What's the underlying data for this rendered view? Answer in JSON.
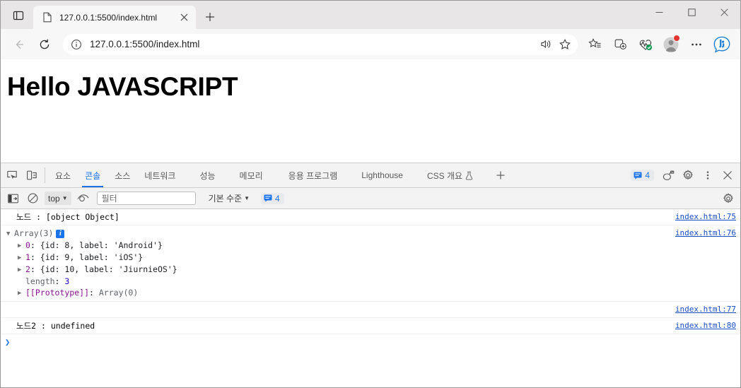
{
  "window": {
    "minimize_label": "−",
    "maximize_label": "□",
    "close_label": "×"
  },
  "tabstrip": {
    "tab_search_icon": "tab-search-icon",
    "tabs": [
      {
        "title": "127.0.0.1:5500/index.html",
        "favicon": "document-icon",
        "close_label": "×",
        "active": true
      }
    ],
    "new_tab_label": "+"
  },
  "toolbar": {
    "back_label": "←",
    "forward_label": "→",
    "refresh_label": "⟳",
    "info_icon": "site-info-icon",
    "url": "127.0.0.1:5500/index.html",
    "read_aloud_icon": "read-aloud-icon",
    "favorite_icon": "star-icon",
    "collections_icon": "collections-star-icon",
    "add_tab_group_icon": "add-tab-group-icon",
    "browser_essentials_icon": "browser-essentials-icon",
    "profile_icon": "profile-avatar-icon",
    "settings_more_icon": "more-options-icon",
    "copilot_icon": "bing-copilot-icon"
  },
  "page": {
    "heading": "Hello JAVASCRIPT"
  },
  "devtools": {
    "inspect_icon": "inspect-element-icon",
    "device_toolbar_icon": "device-toolbar-icon",
    "tabs": [
      {
        "label": "요소",
        "active": false
      },
      {
        "label": "콘솔",
        "active": true
      },
      {
        "label": "소스",
        "active": false
      },
      {
        "label": "네트워크",
        "active": false
      },
      {
        "label": "성능",
        "active": false
      },
      {
        "label": "메모리",
        "active": false
      },
      {
        "label": "응용 프로그램",
        "active": false
      },
      {
        "label": "Lighthouse",
        "active": false
      },
      {
        "label": "CSS 개요",
        "active": false,
        "experiment_icon": "flask-icon"
      }
    ],
    "more_tabs_label": "+",
    "message_badge_count": "4",
    "message_badge_icon": "message-icon",
    "drawer_icon": "inspector-drawer-icon",
    "settings_icon": "gear-icon",
    "more_icon": "kebab-menu-icon",
    "close_icon": "close-icon"
  },
  "console_toolbar": {
    "sidebar_toggle_icon": "console-sidebar-icon",
    "clear_console_icon": "clear-console-icon",
    "context_value": "top",
    "context_caret": "▼",
    "live_expression_icon": "eye-icon",
    "filter_placeholder": "필터",
    "filter_value": "",
    "levels_label": "기본 수준",
    "levels_caret": "▼",
    "badge_count": "4",
    "badge_icon": "message-icon",
    "settings_icon": "gear-icon"
  },
  "console_logs": [
    {
      "id": "log-node-object",
      "type": "text",
      "text": "노드 : [object Object]",
      "source": "index.html:75"
    },
    {
      "id": "log-array",
      "type": "array",
      "toggle": "▼",
      "header": "Array(3)",
      "info_badge": "i",
      "source": "index.html:76",
      "entries": [
        {
          "toggle": "▶",
          "key": "0",
          "value": "{id: 8, label: 'Android'}",
          "id_num": "8",
          "label_str": "'Android'"
        },
        {
          "toggle": "▶",
          "key": "1",
          "value": "{id: 9, label: 'iOS'}",
          "id_num": "9",
          "label_str": "'iOS'"
        },
        {
          "toggle": "▶",
          "key": "2",
          "value": "{id: 10, label: 'JiurnieOS'}",
          "id_num": "10",
          "label_str": "'JiurnieOS'"
        }
      ],
      "length_key": "length",
      "length_value": "3",
      "prototype_toggle": "▶",
      "prototype_key": "[[Prototype]]",
      "prototype_value": "Array(0)"
    },
    {
      "id": "log-empty",
      "type": "empty",
      "text": "",
      "source": "index.html:77"
    },
    {
      "id": "log-node2",
      "type": "text",
      "text": "노드2 : undefined",
      "source": "index.html:80"
    }
  ],
  "console_prompt": {
    "caret": "❯"
  },
  "colors": {
    "accent_blue": "#1a73e8",
    "link_blue": "#1a4cc4",
    "string_red": "#c41a16",
    "number_blue": "#1c00cf",
    "key_purple": "#881391",
    "gray": "#5f6368"
  }
}
